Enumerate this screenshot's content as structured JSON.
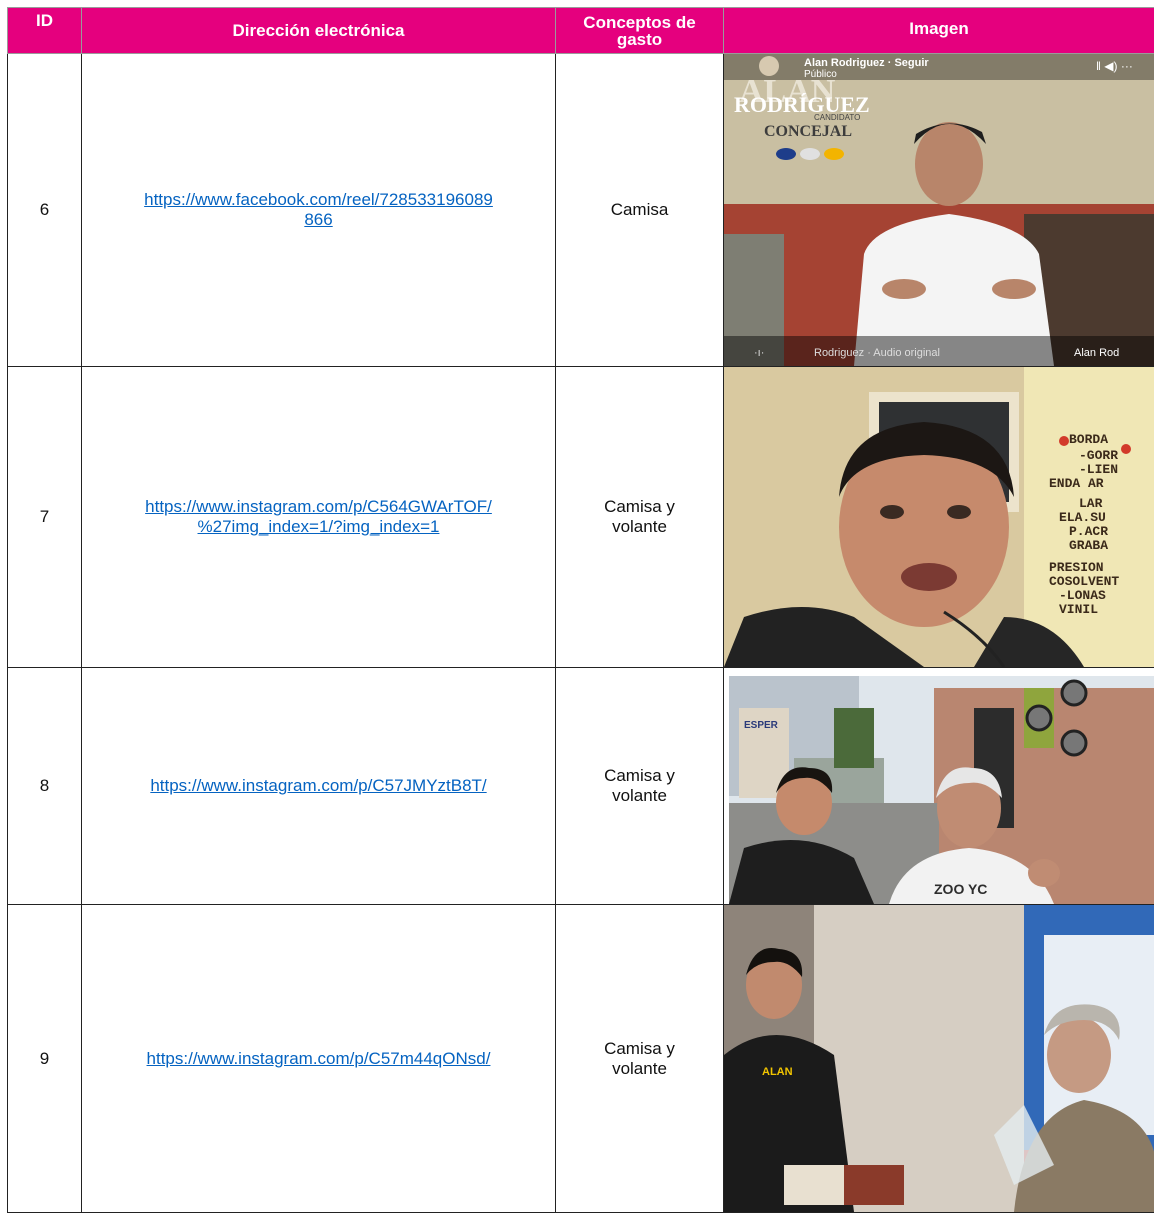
{
  "headers": {
    "id": "ID",
    "url": "Dirección electrónica",
    "concept": "Conceptos de gasto",
    "image": "Imagen"
  },
  "rows": [
    {
      "id": "6",
      "url_line1": "https://www.facebook.com/reel/728533196089",
      "url_line2": "866",
      "concept": "Camisa",
      "photo": {
        "top_name": "Alan Rodriguez · Seguir",
        "top_sub": "Público",
        "poster_name": "ALAN",
        "poster_surname": "RODRÍGUEZ",
        "poster_role": "CONCEJAL",
        "poster_small": "CANDIDATO",
        "bottom_audio": "Rodriguez · Audio original",
        "bottom_right": "Alan Rod"
      }
    },
    {
      "id": "7",
      "url_line1": "https://www.instagram.com/p/C564GWArTOF/",
      "url_line2": "%27img_index=1/?img_index=1",
      "concept": "Camisa y\nvolante",
      "photo": {
        "wall_text": [
          "BORDA",
          "-GORR",
          "-LIEN",
          "ENDA AR",
          "LAR",
          "ELA.SU",
          "P.ACR",
          "GRABA",
          "PRESION",
          "COSOLVENT",
          "-LONAS",
          "VINIL"
        ]
      }
    },
    {
      "id": "8",
      "url_line1": "https://www.instagram.com/p/C57JMYztB8T/",
      "url_line2": "",
      "concept": "Camisa y\nvolante",
      "photo": {
        "sign": "ESPER",
        "shirt": "ZOO YC"
      }
    },
    {
      "id": "9",
      "url_line1": "https://www.instagram.com/p/C57m44qONsd/",
      "url_line2": "",
      "concept": "Camisa y\nvolante",
      "photo": {
        "logo": "ALAN"
      }
    }
  ]
}
